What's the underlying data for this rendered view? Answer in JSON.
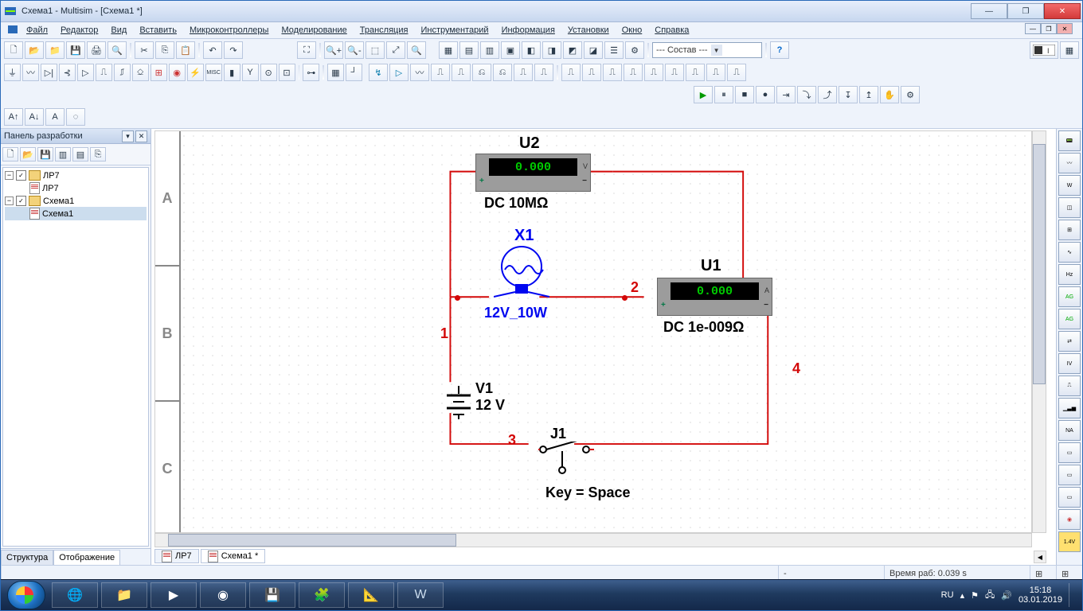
{
  "window": {
    "title": "Схема1 - Multisim - [Схема1 *]"
  },
  "menu": [
    "Файл",
    "Редактор",
    "Вид",
    "Вставить",
    "Микроконтроллеры",
    "Моделирование",
    "Трансляция",
    "Инструментарий",
    "Информация",
    "Установки",
    "Окно",
    "Справка"
  ],
  "combo_layer": "--- Состав ---",
  "left_panel": {
    "title": "Панель разработки",
    "items": [
      {
        "type": "proj",
        "label": "ЛР7",
        "checked": true
      },
      {
        "type": "doc",
        "label": "ЛР7"
      },
      {
        "type": "proj",
        "label": "Схема1",
        "checked": true
      },
      {
        "type": "doc",
        "label": "Схема1",
        "selected": true
      }
    ],
    "tabs": [
      "Структура",
      "Отображение"
    ],
    "active_tab": 1
  },
  "canvas_tabs": [
    {
      "label": "ЛР7",
      "active": false
    },
    {
      "label": "Схема1 *",
      "active": true
    }
  ],
  "ruler_rows": [
    "A",
    "B",
    "C"
  ],
  "schematic": {
    "U2": {
      "name": "U2",
      "value": "0.000",
      "sub": "DC  10MΩ"
    },
    "U1": {
      "name": "U1",
      "value": "0.000",
      "sub": "DC  1e-009Ω"
    },
    "X1": {
      "name": "X1",
      "sub": "12V_10W"
    },
    "V1": {
      "name": "V1",
      "sub": "12 V"
    },
    "J1": {
      "name": "J1",
      "sub": "Key = Space"
    },
    "nets": {
      "1": "1",
      "2": "2",
      "3": "3",
      "4": "4"
    }
  },
  "status": {
    "sim_time": "Время раб: 0.039 s",
    "lang": "RU"
  },
  "clock": {
    "time": "15:18",
    "date": "03.01.2019"
  }
}
